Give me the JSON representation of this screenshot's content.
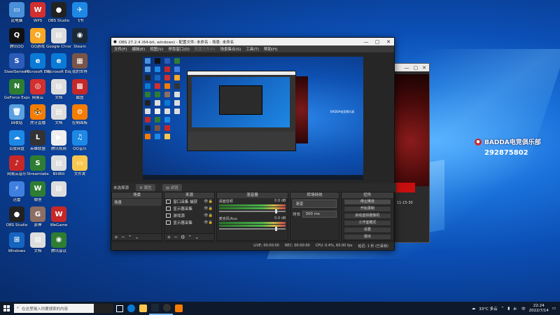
{
  "desktop_icons": [
    {
      "label": "此电脑",
      "color": "#4a90d9",
      "glyph": "▭"
    },
    {
      "label": "腾讯QQ",
      "color": "#111",
      "glyph": "Q"
    },
    {
      "label": "SteelSeries GG",
      "color": "#2a5cb8",
      "glyph": "S"
    },
    {
      "label": "GeForce Experience",
      "color": "#2e7d32",
      "glyph": "N"
    },
    {
      "label": "回收站",
      "color": "#5aa0e0",
      "glyph": "🗑"
    },
    {
      "label": "百度网盘",
      "color": "#1e88e5",
      "glyph": "☁"
    },
    {
      "label": "网易云音乐",
      "color": "#c62828",
      "glyph": "♪"
    },
    {
      "label": "迅雷",
      "color": "#3f7fe0",
      "glyph": "⚡"
    },
    {
      "label": "OBS Studio",
      "color": "#222",
      "glyph": "●"
    },
    {
      "label": "Windows",
      "color": "#1565c0",
      "glyph": "⊞"
    },
    {
      "label": "WPS",
      "color": "#d32f2f",
      "glyph": "W"
    },
    {
      "label": "QQ游戏",
      "color": "#f9a825",
      "glyph": "Q"
    },
    {
      "label": "Microsoft Edge",
      "color": "#0a7ad6",
      "glyph": "e"
    },
    {
      "label": "网易云",
      "color": "#d32f2f",
      "glyph": "◎"
    },
    {
      "label": "虎牙直播",
      "color": "#f57c00",
      "glyph": "🐯"
    },
    {
      "label": "英雄联盟",
      "color": "#333",
      "glyph": "L"
    },
    {
      "label": "Streamlabs",
      "color": "#2e7d32",
      "glyph": "S"
    },
    {
      "label": "微信",
      "color": "#2e7d32",
      "glyph": "W"
    },
    {
      "label": "原神",
      "color": "#8d6e63",
      "glyph": "G"
    },
    {
      "label": "文档",
      "color": "#ddd",
      "glyph": "▤"
    },
    {
      "label": "OBS Studio",
      "color": "#222",
      "glyph": "●"
    },
    {
      "label": "Google Chrome",
      "color": "#ddd",
      "glyph": "▤"
    },
    {
      "label": "Microsoft Edge",
      "color": "#0a7ad6",
      "glyph": "e"
    },
    {
      "label": "文档",
      "color": "#ddd",
      "glyph": "▤"
    },
    {
      "label": "文档",
      "color": "#ddd",
      "glyph": "▤"
    },
    {
      "label": "腾讯视频",
      "color": "#eee",
      "glyph": "▶"
    },
    {
      "label": "BiliBili",
      "color": "#ddd",
      "glyph": "▤"
    },
    {
      "label": "",
      "color": "#ddd",
      "glyph": "▤"
    },
    {
      "label": "WeGame",
      "color": "#c62828",
      "glyph": "W"
    },
    {
      "label": "腾讯会议",
      "color": "#2e7d32",
      "glyph": "◉"
    },
    {
      "label": "飞书",
      "color": "#1e88e5",
      "glyph": "✈"
    },
    {
      "label": "Steam",
      "color": "#1b2838",
      "glyph": "◉"
    },
    {
      "label": "我的世界",
      "color": "#795548",
      "glyph": "▦"
    },
    {
      "label": "截图",
      "color": "#c62828",
      "glyph": "▩"
    },
    {
      "label": "控制面板",
      "color": "#f57c00",
      "glyph": "⚙"
    },
    {
      "label": "QQ音乐",
      "color": "#1e88e5",
      "glyph": "♫"
    },
    {
      "label": "文件夹",
      "color": "#f9c74f",
      "glyph": "▭"
    }
  ],
  "streamer": {
    "name": "BADDA电竞俱乐部",
    "id": "292875802"
  },
  "bg_window": {
    "timestamp": "11-15-30"
  },
  "obs": {
    "title": "OBS 27.2.4 (64-bit, windows) - 配置文件: 未命名 - 场景: 未命名",
    "menu": [
      "文件(F)",
      "编辑(E)",
      "视图(V)",
      "停靠窗口(D)",
      "配置文件(P)",
      "场景集合(S)",
      "工具(T)",
      "帮助(H)"
    ],
    "no_source_label": "未选择源",
    "props_btn": "属性",
    "filters_btn": "滤镜",
    "docks": {
      "scenes": {
        "title": "场景",
        "items": [
          "场景"
        ]
      },
      "sources": {
        "title": "来源",
        "items": [
          "窗口采集 捕获",
          "显示器采集",
          "游戏源",
          "显示器采集"
        ]
      },
      "mixer": {
        "title": "混音器",
        "channels": [
          {
            "name": "桌面音频",
            "db": "0.0 dB"
          },
          {
            "name": "麦克风/Aux",
            "db": "0.0 dB"
          }
        ]
      },
      "transitions": {
        "title": "转场特效",
        "type": "渐变",
        "duration_label": "时长",
        "duration": "300 ms"
      },
      "controls": {
        "title": "控件",
        "buttons": [
          "停止推流",
          "开始录制",
          "启动虚拟摄像机",
          "工作室模式",
          "设置",
          "退出"
        ]
      }
    },
    "status": {
      "live": "LIVE: 00:00:00",
      "rec": "REC: 00:00:00",
      "cpu": "CPU: 0.4%, 60.00 fps",
      "delay": "延迟: 1 秒 (已丢帧)"
    }
  },
  "taskbar": {
    "search_placeholder": "在这里输入你要搜索的内容",
    "weather": "33°C 多云",
    "time": "22:24",
    "date": "2022/7/14"
  }
}
